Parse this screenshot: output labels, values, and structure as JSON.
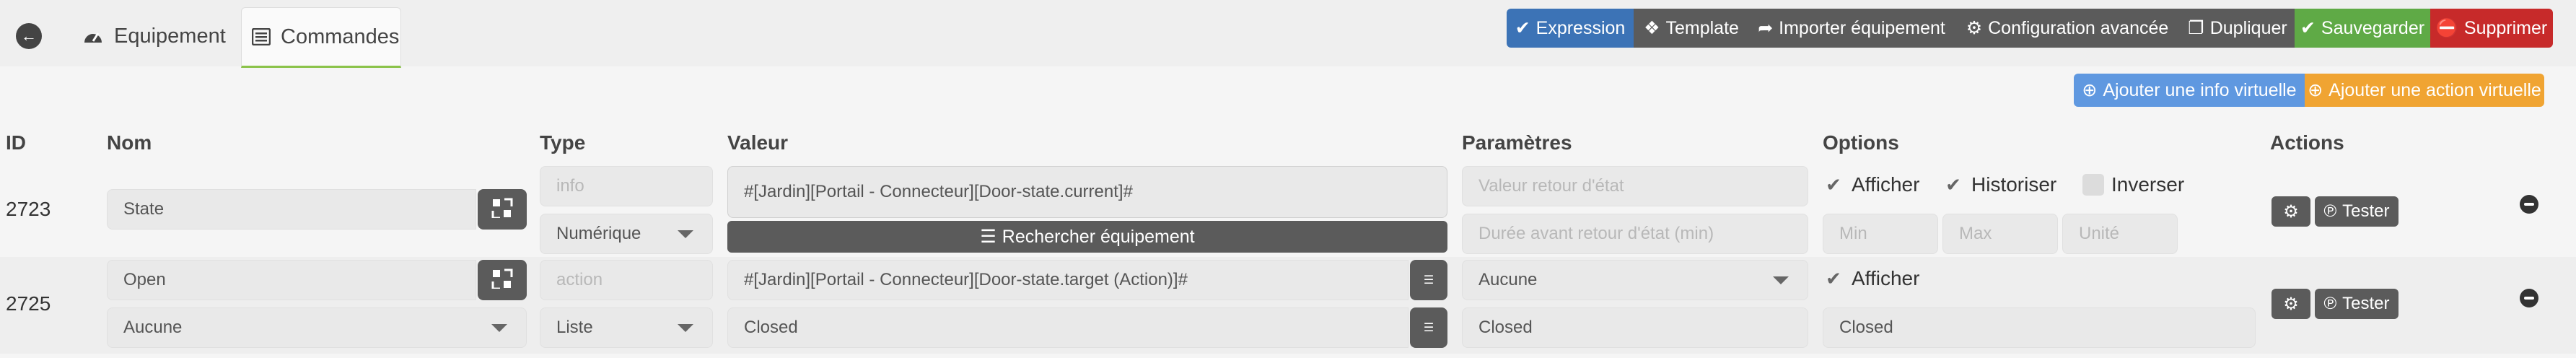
{
  "tabs": {
    "equipment_label": "Equipement",
    "commands_label": "Commandes"
  },
  "toolbar": {
    "expression": "Expression",
    "template": "Template",
    "import": "Importer équipement",
    "advanced": "Configuration avancée",
    "duplicate": "Dupliquer",
    "save": "Sauvegarder",
    "delete": "Supprimer"
  },
  "actions_bar": {
    "add_info": "Ajouter une info virtuelle",
    "add_action": "Ajouter une action virtuelle"
  },
  "columns": {
    "id": "ID",
    "name": "Nom",
    "type": "Type",
    "value": "Valeur",
    "params": "Paramètres",
    "options": "Options",
    "actions": "Actions"
  },
  "rows": [
    {
      "id": "2723",
      "name": "State",
      "type_placeholder": "info",
      "subtype": "Numérique",
      "value": "#[Jardin][Portail - Connecteur][Door-state.current]#",
      "search_label": "Rechercher équipement",
      "param1_placeholder": "Valeur retour d'état",
      "param2_placeholder": "Durée avant retour d'état (min)",
      "opt_display": "Afficher",
      "opt_history": "Historiser",
      "opt_invert": "Inverser",
      "min_placeholder": "Min",
      "max_placeholder": "Max",
      "unit_placeholder": "Unité",
      "test_label": "Tester"
    },
    {
      "id": "2725",
      "name": "Open",
      "linked": "Aucune",
      "type_placeholder": "action",
      "subtype": "Liste",
      "value": "#[Jardin][Portail - Connecteur][Door-state.target (Action)]#",
      "list_value": "Closed",
      "param_select": "Aucune",
      "param_value": "Closed",
      "opt_display": "Afficher",
      "opt_value": "Closed",
      "test_label": "Tester"
    }
  ],
  "colors": {
    "expression": "#3c73b6",
    "dark": "#5b5b5b",
    "save": "#5faa46",
    "delete": "#c72a2a",
    "add_info": "#5f98e0",
    "add_action": "#f0a432",
    "tab_accent": "#8bc34a"
  }
}
